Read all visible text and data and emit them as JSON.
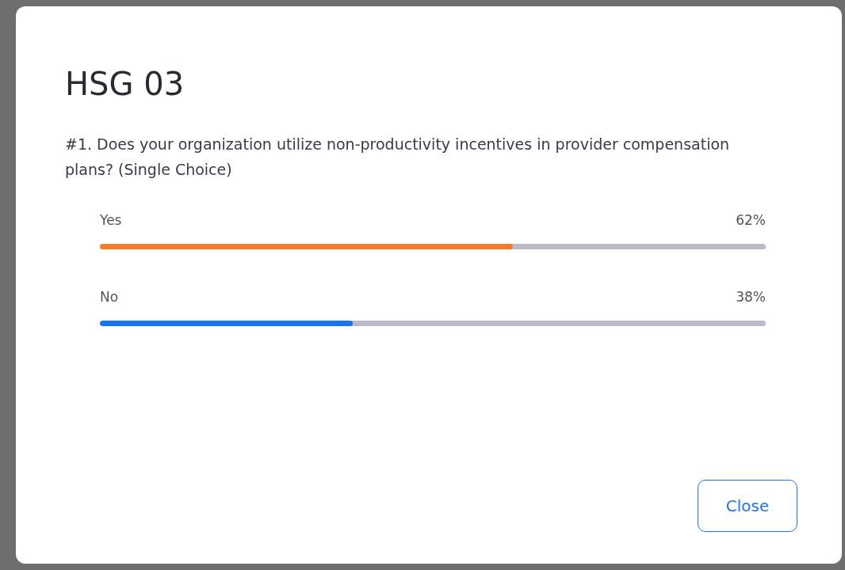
{
  "dialog": {
    "title": "HSG 03",
    "question": "#1. Does your organization utilize non-productivity incentives in provider compensation plans? (Single Choice)",
    "options": [
      {
        "label": "Yes",
        "reading": "62%",
        "level": 0.62,
        "color": "#fa7a2c"
      },
      {
        "label": "No",
        "reading": "38%",
        "level": 0.38,
        "color": "#1a73e8"
      }
    ],
    "buttons": [
      "Close"
    ]
  }
}
